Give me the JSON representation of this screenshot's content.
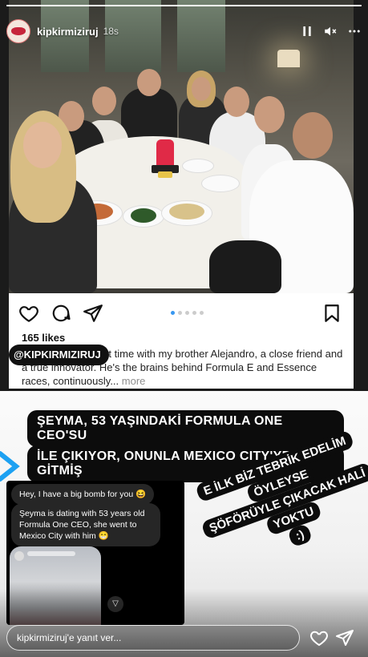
{
  "story": {
    "username": "kipkirmiziruj",
    "time_ago": "18s",
    "progress": 1.0
  },
  "post": {
    "likes": "165 likes",
    "username_chip": "@KIPKIRMIZIRUJ",
    "caption_visible": "li Last night, I spent time with my brother Alejandro, a close friend and a true innovator. He's the brains behind Formula E and Essence races, continuously...",
    "more_label": "more",
    "carousel_count": 5,
    "carousel_active": 1
  },
  "headline": {
    "line1": "ŞEYMA, 53 YAŞINDAKİ FORMULA ONE CEO'SU",
    "line2": "İLE ÇIKIYOR, ONUNLA MEXICO CITY'YE GİTMİŞ"
  },
  "dm": {
    "message1": "Hey, I have a big bomb for you 😆",
    "message2": "Şeyma is dating with 53 years old Formula One CEO, she went to Mexico City with him 😁"
  },
  "comment": {
    "line1": "E İLK BİZ TEBRİK EDELİM",
    "line2": "ÖYLEYSE",
    "line3": "ŞÖFÖRÜYLE ÇIKACAK HALİ",
    "line4": "YOKTU",
    "line5": ":)"
  },
  "reply": {
    "placeholder": "kipkirmiziruj'e yanıt ver..."
  },
  "colors": {
    "headline_bg": "#0c0c0c",
    "candle": "#e02a47",
    "carousel_active": "#3897f0"
  }
}
